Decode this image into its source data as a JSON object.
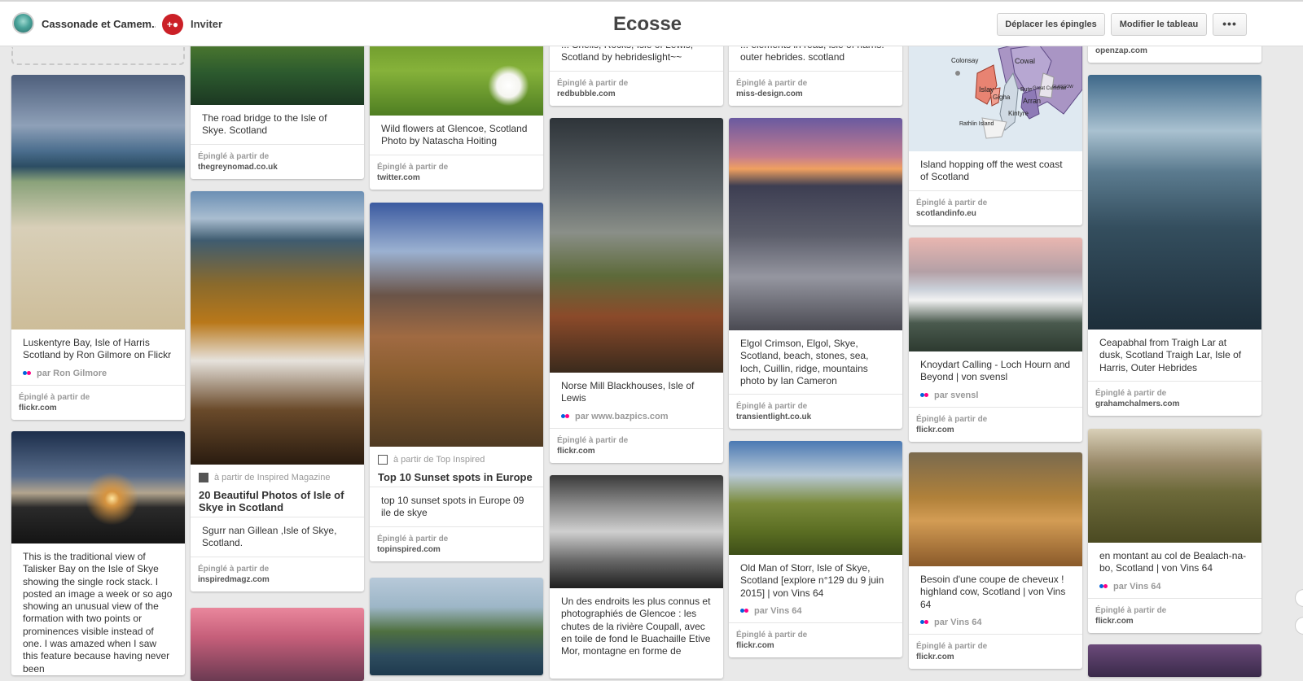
{
  "header": {
    "owner": "Cassonade et Camem...",
    "invite": "Inviter",
    "title": "Ecosse",
    "move_pins": "Déplacer les épingles",
    "edit_board": "Modifier le tableau",
    "more": "•••"
  },
  "labels": {
    "pinned_from": "Épinglé à partir de"
  },
  "pins": {
    "luskentyre": {
      "desc": "Luskentyre Bay, Isle of Harris Scotland by Ron Gilmore on Flickr",
      "attribution": "par Ron Gilmore",
      "site": "flickr.com"
    },
    "talisker": {
      "desc": "This is the traditional view of Talisker Bay on the Isle of Skye showing the single rock stack. I posted an image a week or so ago showing an unusual view of the formation with two points or prominences visible instead of one. I was amazed when I saw this feature because having never been"
    },
    "bridge": {
      "desc": "The road bridge to the Isle of Skye. Scotland",
      "site": "thegreynomad.co.uk"
    },
    "skye_photos": {
      "source": "à partir de Inspired Magazine",
      "title": "20 Beautiful Photos of Isle of Skye in Scotland",
      "desc": "Sgurr nan Gillean ,Isle of Skye, Scotland.",
      "site": "inspiredmagz.com"
    },
    "glencoe_flowers": {
      "desc": "Wild flowers at Glencoe, Scotland Photo by Natascha Hoiting",
      "site": "twitter.com"
    },
    "sunset_spots": {
      "source": "à partir de Top Inspired",
      "title": "Top 10 Sunset spots in Europe",
      "desc": "top 10 sunset spots in Europe 09 ile de skye",
      "site": "topinspired.com"
    },
    "lewis_top": {
      "desc": "... Shells, Rocks, Isle of Lewis, Scotland by hebrideslight~~",
      "site": "redbubble.com"
    },
    "mill": {
      "desc": "Norse Mill Blackhouses, Isle of Lewis",
      "attribution": "par www.bazpics.com",
      "site": "flickr.com"
    },
    "coupall": {
      "desc": "Un des endroits les plus connus et photographiés de Glencoe : les chutes de la rivière Coupall, avec en toile de fond le Buachaille Etive Mor, montagne en forme de"
    },
    "outer_top": {
      "desc": "... elements in read, isle of harris. outer hebrides. scotland",
      "site": "miss-design.com"
    },
    "elgol": {
      "desc": "Elgol Crimson, Elgol, Skye, Scotland, beach, stones, sea, loch, Cuillin, ridge, mountains photo by Ian Cameron",
      "site": "transientlight.co.uk"
    },
    "storr": {
      "desc": "Old Man of Storr, Isle of Skye, Scotland [explore n°129 du 9 juin 2015] | von Vins 64",
      "attribution": "par Vins 64",
      "site": "flickr.com"
    },
    "island_hopping": {
      "desc": "Island hopping off the west coast of Scotland",
      "site": "scotlandinfo.eu",
      "map_labels": {
        "colonsay": "Colonsay",
        "cowal": "Cowal",
        "islay": "Islay",
        "gigha": "Gigha",
        "bute": "Bute",
        "cumbrae": "Great Cumbrae",
        "glasgow": "GLASGOW",
        "arran": "Arran",
        "kintyre": "Kintyre",
        "rathlin": "Rathlin Island"
      }
    },
    "knoydart": {
      "desc": "Knoydart Calling - Loch Hourn and Beyond | von svensl",
      "attribution": "par svensl",
      "site": "flickr.com"
    },
    "cow": {
      "desc": "Besoin d'une coupe de cheveux ! highland cow, Scotland | von Vins 64",
      "attribution": "par Vins 64",
      "site": "flickr.com"
    },
    "openzap": {
      "site": "openzap.com"
    },
    "ceapabhal": {
      "desc": "Ceapabhal from Traigh Lar at dusk, Scotland Traigh Lar, Isle of Harris, Outer Hebrides",
      "site": "grahamchalmers.com"
    },
    "bealach": {
      "desc": "en montant au col de Bealach-na-bo, Scotland | von Vins 64",
      "attribution": "par Vins 64",
      "site": "flickr.com"
    }
  }
}
